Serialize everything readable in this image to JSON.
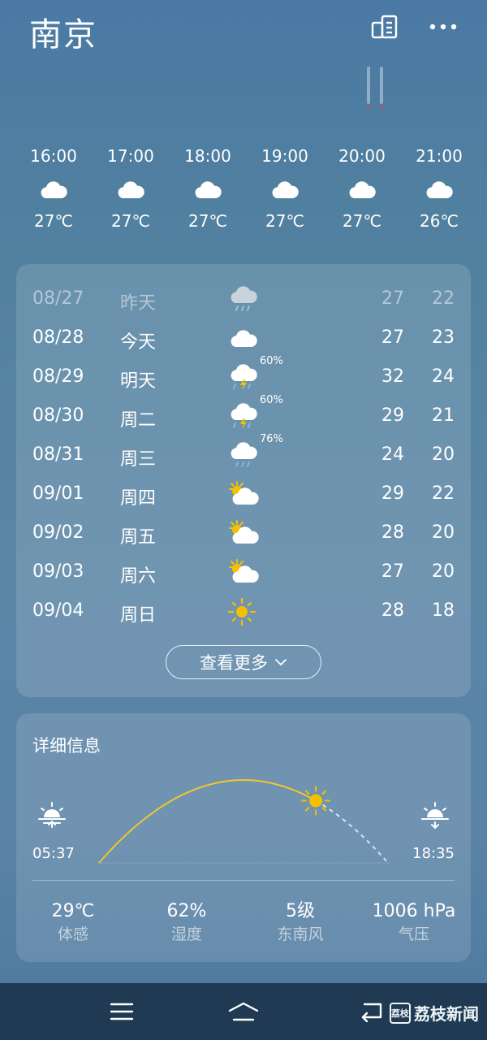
{
  "header": {
    "city": "南京"
  },
  "hourly": [
    {
      "time": "16:00",
      "icon": "cloud-icon",
      "temp": "27℃"
    },
    {
      "time": "17:00",
      "icon": "cloud-icon",
      "temp": "27℃"
    },
    {
      "time": "18:00",
      "icon": "cloud-icon",
      "temp": "27℃"
    },
    {
      "time": "19:00",
      "icon": "cloud-icon",
      "temp": "27℃"
    },
    {
      "time": "20:00",
      "icon": "cloud-icon",
      "temp": "27℃"
    },
    {
      "time": "21:00",
      "icon": "cloud-icon",
      "temp": "26℃"
    }
  ],
  "daily": [
    {
      "date": "08/27",
      "weekday": "昨天",
      "icon": "rain-cloud-icon",
      "precip": "",
      "high": "27",
      "low": "22"
    },
    {
      "date": "08/28",
      "weekday": "今天",
      "icon": "cloud-icon",
      "precip": "",
      "high": "27",
      "low": "23"
    },
    {
      "date": "08/29",
      "weekday": "明天",
      "icon": "thunderstorm-icon",
      "precip": "60%",
      "high": "32",
      "low": "24"
    },
    {
      "date": "08/30",
      "weekday": "周二",
      "icon": "thunderstorm-icon",
      "precip": "60%",
      "high": "29",
      "low": "21"
    },
    {
      "date": "08/31",
      "weekday": "周三",
      "icon": "rain-cloud-icon",
      "precip": "76%",
      "high": "24",
      "low": "20"
    },
    {
      "date": "09/01",
      "weekday": "周四",
      "icon": "partly-cloudy-icon",
      "precip": "",
      "high": "29",
      "low": "22"
    },
    {
      "date": "09/02",
      "weekday": "周五",
      "icon": "partly-cloudy-icon",
      "precip": "",
      "high": "28",
      "low": "20"
    },
    {
      "date": "09/03",
      "weekday": "周六",
      "icon": "partly-cloudy-icon",
      "precip": "",
      "high": "27",
      "low": "20"
    },
    {
      "date": "09/04",
      "weekday": "周日",
      "icon": "sun-icon",
      "precip": "",
      "high": "28",
      "low": "18"
    }
  ],
  "more_button": {
    "label": "查看更多"
  },
  "details": {
    "title": "详细信息",
    "sunrise": "05:37",
    "sunset": "18:35",
    "sun_progress": 0.75,
    "stats": [
      {
        "value": "29℃",
        "label": "体感"
      },
      {
        "value": "62%",
        "label": "湿度"
      },
      {
        "value": "5级",
        "label": "东南风"
      },
      {
        "value": "1006 hPa",
        "label": "气压"
      }
    ]
  },
  "watermark": {
    "text": "荔枝新闻",
    "badge": "荔枝"
  },
  "colors": {
    "sun": "#f5c000",
    "arc": "#f2c62e"
  }
}
